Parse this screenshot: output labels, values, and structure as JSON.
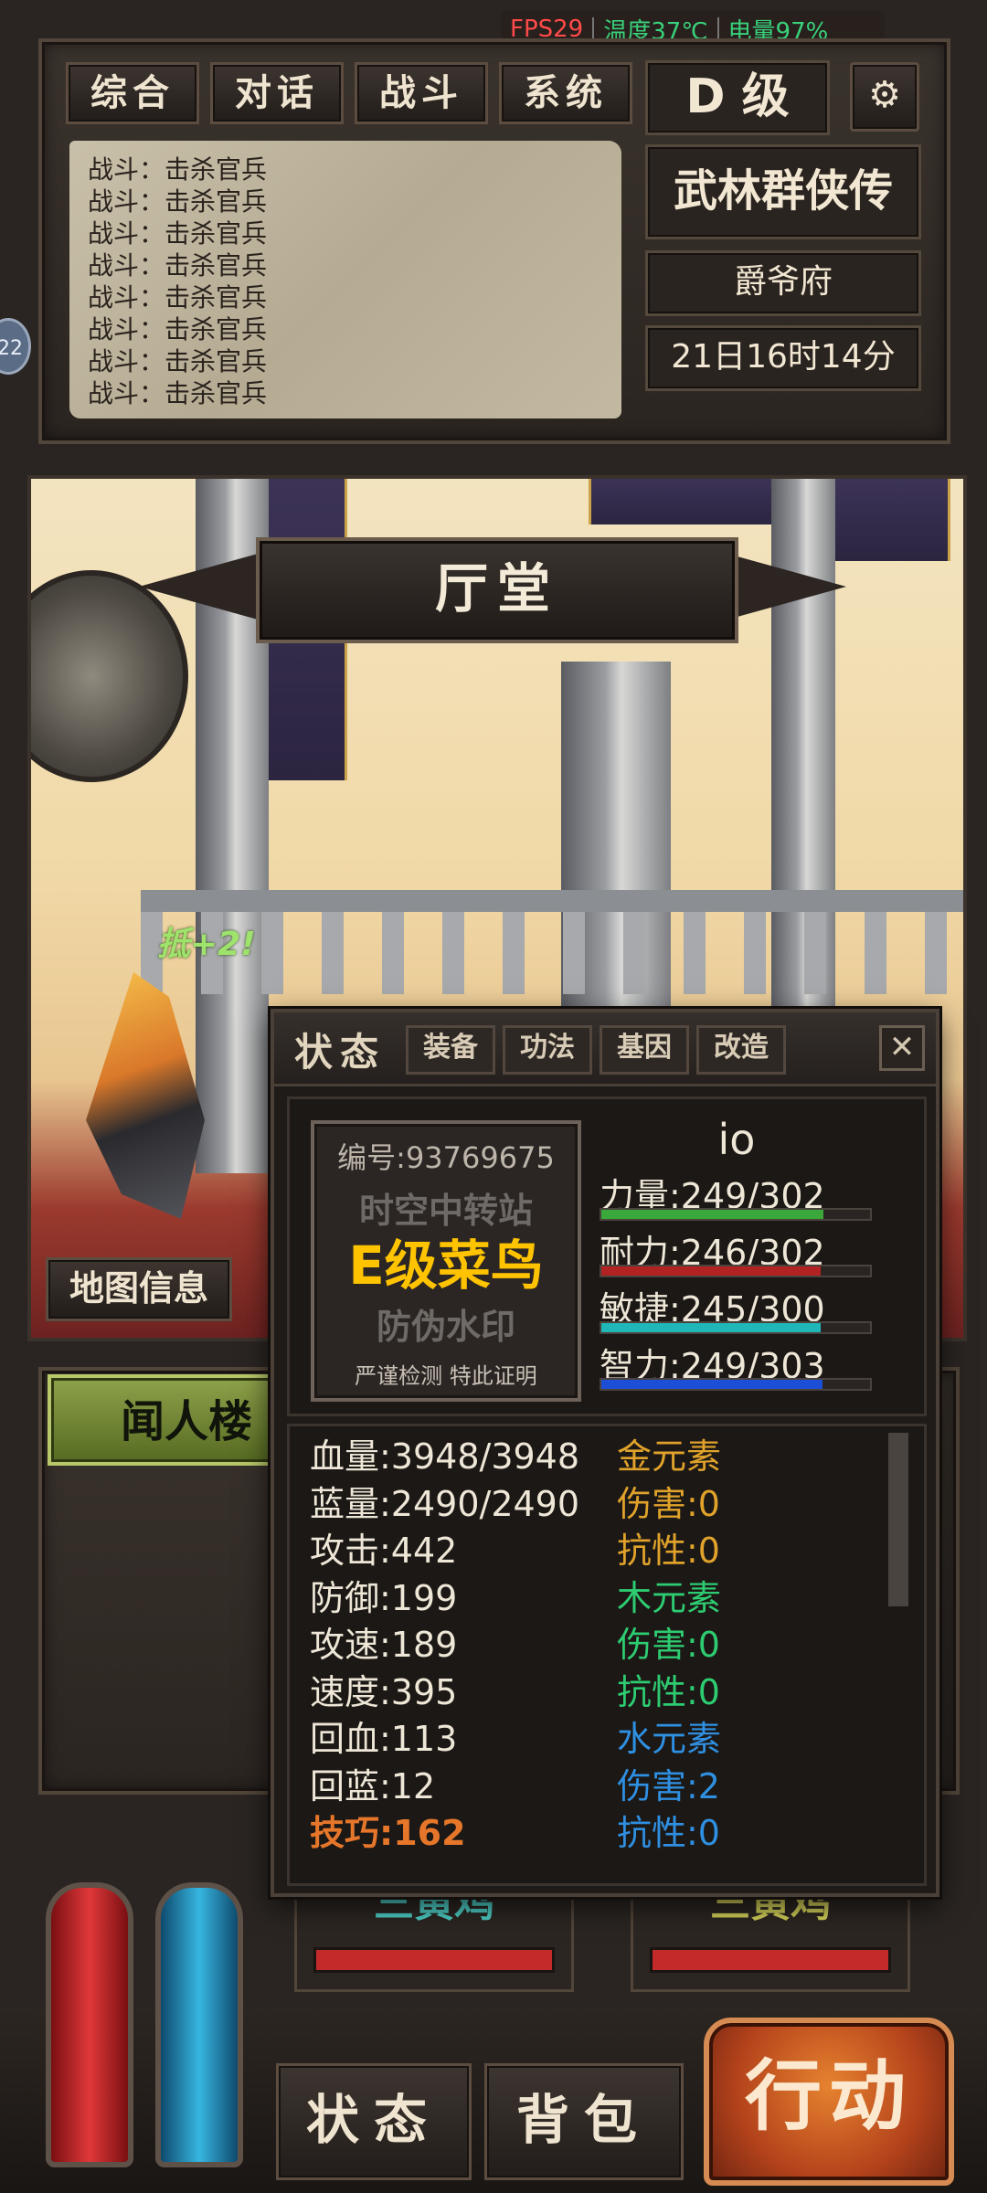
{
  "status_bar": {
    "fps": "FPS29",
    "temperature": "温度37℃",
    "battery": "电量97%"
  },
  "top_tabs": [
    "综合",
    "对话",
    "战斗",
    "系统"
  ],
  "grade": "D 级",
  "game_title": "武林群侠传",
  "location_name": "爵爷府",
  "game_time": "21日16时14分",
  "side_badge": "22",
  "battle_log": [
    "战斗：击杀官兵",
    "战斗：击杀官兵",
    "战斗：击杀官兵",
    "战斗：击杀官兵",
    "战斗：击杀官兵",
    "战斗：击杀官兵",
    "战斗：击杀官兵",
    "战斗：击杀官兵"
  ],
  "room_title": "厅堂",
  "combat_popup": "抵+2!",
  "map_info_label": "地图信息",
  "npc_button": "闻人楼",
  "enemies": [
    {
      "name": "三黄鸡"
    },
    {
      "name": "三黄鸡"
    }
  ],
  "bottom_buttons": {
    "status": "状态",
    "bag": "背包",
    "action": "行动"
  },
  "dialog": {
    "title": "状态",
    "tabs": [
      "装备",
      "功法",
      "基因",
      "改造"
    ],
    "close": "✕",
    "watermark": {
      "id_line": "编号:93769675",
      "line1": "时空中转站",
      "line2": "E级菜鸟",
      "line3": "防伪水印",
      "line4": "严谨检测 特此证明"
    },
    "player_name": "io",
    "attributes": [
      {
        "label": "力量:249/302",
        "value": 249,
        "max": 302,
        "color": "#3aa83a"
      },
      {
        "label": "耐力:246/302",
        "value": 246,
        "max": 302,
        "color": "#b22222"
      },
      {
        "label": "敏捷:245/300",
        "value": 245,
        "max": 300,
        "color": "#1fb7b7"
      },
      {
        "label": "智力:249/303",
        "value": 249,
        "max": 303,
        "color": "#1d4fd6"
      }
    ],
    "left_stats": [
      {
        "text": "血量:3948/3948",
        "color": "#eee6d6"
      },
      {
        "text": "蓝量:2490/2490",
        "color": "#eee6d6"
      },
      {
        "text": "攻击:442",
        "color": "#eee6d6"
      },
      {
        "text": "防御:199",
        "color": "#eee6d6"
      },
      {
        "text": "攻速:189",
        "color": "#eee6d6"
      },
      {
        "text": "速度:395",
        "color": "#eee6d6"
      },
      {
        "text": "回血:113",
        "color": "#eee6d6"
      },
      {
        "text": "回蓝:12",
        "color": "#eee6d6"
      },
      {
        "text": "技巧:162",
        "color": "#e6762a"
      }
    ],
    "right_stats": [
      {
        "text": "金元素",
        "color": "#e0a22a"
      },
      {
        "text": "伤害:0",
        "color": "#e0a22a"
      },
      {
        "text": "抗性:0",
        "color": "#e0a22a"
      },
      {
        "text": "木元素",
        "color": "#2ecc71"
      },
      {
        "text": "伤害:0",
        "color": "#2ecc71"
      },
      {
        "text": "抗性:0",
        "color": "#2ecc71"
      },
      {
        "text": "水元素",
        "color": "#2f8fe0"
      },
      {
        "text": "伤害:2",
        "color": "#2f8fe0"
      },
      {
        "text": "抗性:0",
        "color": "#2f8fe0"
      }
    ]
  }
}
